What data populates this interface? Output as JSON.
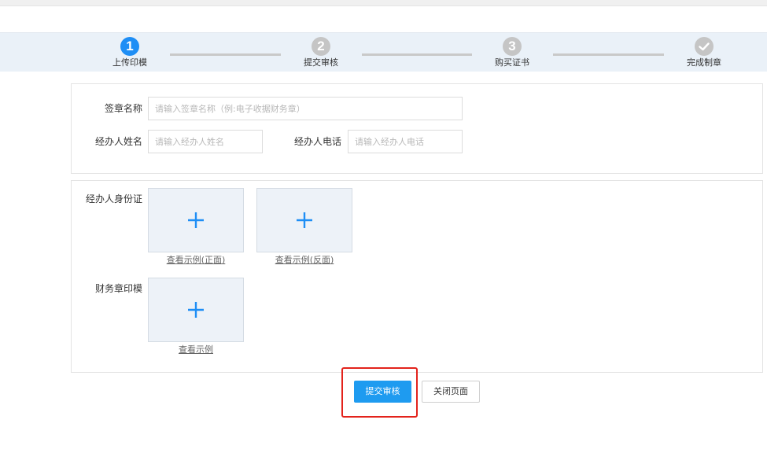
{
  "steps": [
    {
      "number": "1",
      "label": "上传印模",
      "state": "active"
    },
    {
      "number": "2",
      "label": "提交审核",
      "state": "todo"
    },
    {
      "number": "3",
      "label": "购买证书",
      "state": "todo"
    },
    {
      "number": "",
      "label": "完成制章",
      "state": "todo",
      "icon": "check-icon"
    }
  ],
  "form": {
    "seal_name_label": "签章名称",
    "seal_name_placeholder": "请输入签章名称（例:电子收据财务章）",
    "agent_name_label": "经办人姓名",
    "agent_name_placeholder": "请输入经办人姓名",
    "agent_phone_label": "经办人电话",
    "agent_phone_placeholder": "请输入经办人电话"
  },
  "uploads": {
    "id_card_label": "经办人身份证",
    "id_front_link": "查看示例(正面)",
    "id_back_link": "查看示例(反面)",
    "seal_mold_label": "财务章印模",
    "seal_mold_link": "查看示例",
    "plus_icon": "plus-icon",
    "accent": "#1e8ef5"
  },
  "actions": {
    "submit_label": "提交审核",
    "close_label": "关闭页面",
    "highlight_color": "#e3231c"
  }
}
